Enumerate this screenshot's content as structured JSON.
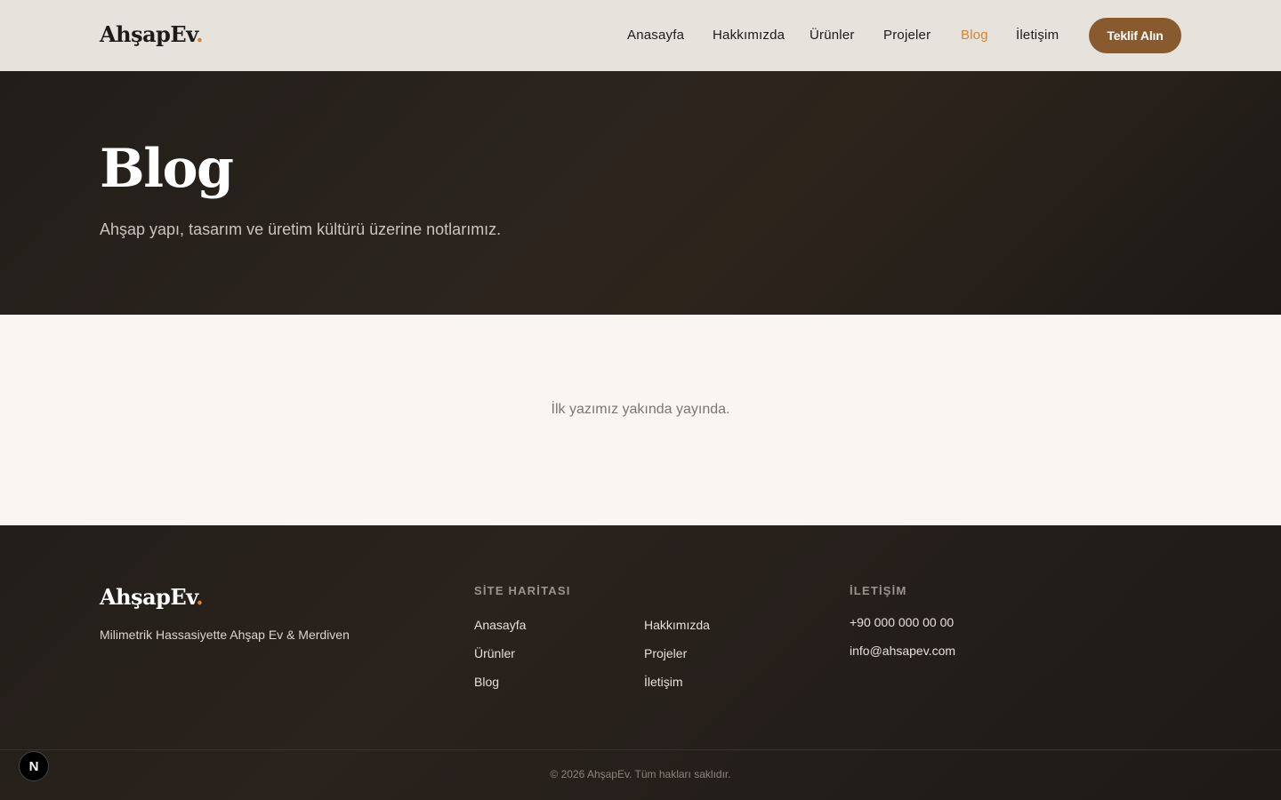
{
  "header": {
    "logo_text": "AhşapEv",
    "logo_dot": ".",
    "nav": [
      {
        "label": "Anasayfa"
      },
      {
        "label": "Hakkımızda"
      },
      {
        "label": "Ürünler"
      },
      {
        "label": "Projeler"
      },
      {
        "label": "Blog",
        "active": true
      },
      {
        "label": "İletişim"
      }
    ],
    "cta_label": "Teklif Alın"
  },
  "hero": {
    "title": "Blog",
    "subtitle": "Ahşap yapı, tasarım ve üretim kültürü üzerine notlarımız."
  },
  "content": {
    "empty_message": "İlk yazımız yakında yayında."
  },
  "footer": {
    "logo_text": "AhşapEv",
    "logo_dot": ".",
    "tagline": "Milimetrik Hassasiyette Ahşap Ev & Merdiven",
    "sitemap_heading": "SİTE HARİTASI",
    "sitemap_links": [
      "Anasayfa",
      "Hakkımızda",
      "Ürünler",
      "Projeler",
      "Blog",
      "İletişim"
    ],
    "contact_heading": "İLETİŞİM",
    "phone": "+90 000 000 00 00",
    "email": "info@ahsapev.com",
    "copyright": "© 2026 AhşapEv. Tüm hakları saklıdır."
  },
  "dev_badge": {
    "letter": "N"
  },
  "colors": {
    "accent": "#d9822b",
    "cta_bg": "#8a5a2f",
    "dark_bg": "#231e1a",
    "light_bg": "#f9f6f1",
    "header_bg": "#e6e3dd"
  }
}
